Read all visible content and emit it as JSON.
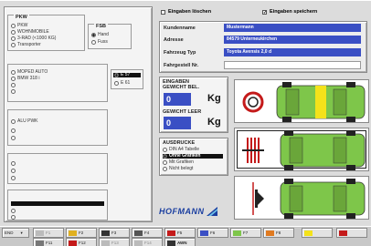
{
  "vehicle_types": {
    "title": "PKW",
    "items": [
      "PKW",
      "WOHNMOBILE",
      "3-RAD (<1000 KG)",
      "Transporter"
    ]
  },
  "fsb": {
    "title": "FSB",
    "items": [
      "Hand",
      "Fuss"
    ]
  },
  "model_list": {
    "items": [
      "MOPED AUTO",
      "BMW 318 i"
    ]
  },
  "selected_model": {
    "items": [
      "E 57",
      "E 61"
    ]
  },
  "list3": {
    "items": [
      "ALU PWK"
    ]
  },
  "options": {
    "delete_inputs": "Eingaben löschen",
    "save_inputs": "Eingaben speichern"
  },
  "form": {
    "kundenname_label": "Kundenname",
    "kundenname_value": "Mustermann",
    "adresse_label": "Adresse",
    "adresse_value": "84579 Unterneukirchen",
    "fahrzeug_typ_label": "Fahrzeug Typ",
    "fahrzeug_typ_value": "Toyota Avensis 2,0 d",
    "fahrgestell_label": "Fahrgestell Nr.",
    "fahrgestell_value": ""
  },
  "eingaben": {
    "title": "EINGABEN",
    "gewicht_bel": "GEWICHT BEL.",
    "gewicht_bel_value": "0",
    "gewicht_leer": "GEWICHT LEER",
    "gewicht_leer_value": "0",
    "unit": "Kg"
  },
  "ausdrucke": {
    "title": "AUSDRUCKE",
    "items": [
      "DIN A4 Tabelle",
      "Ohne Grafiken",
      "Mit Grafiken",
      "Nicht belegt"
    ],
    "selected_index": 1
  },
  "brand": "HOFMANN",
  "toolbar": {
    "left_label": "END",
    "items": [
      "F1",
      "F2",
      "F3",
      "F4",
      "F5",
      "F6",
      "F7",
      "F8"
    ],
    "row2": [
      "F11",
      "F12",
      "F13",
      "F14"
    ],
    "awn_label": "AWN"
  },
  "colors": {
    "field_blue": "#3a4fc4",
    "car_green": "#7ec64a",
    "highlight_yellow": "#f4e21a",
    "tire_red": "#c41a1a"
  }
}
